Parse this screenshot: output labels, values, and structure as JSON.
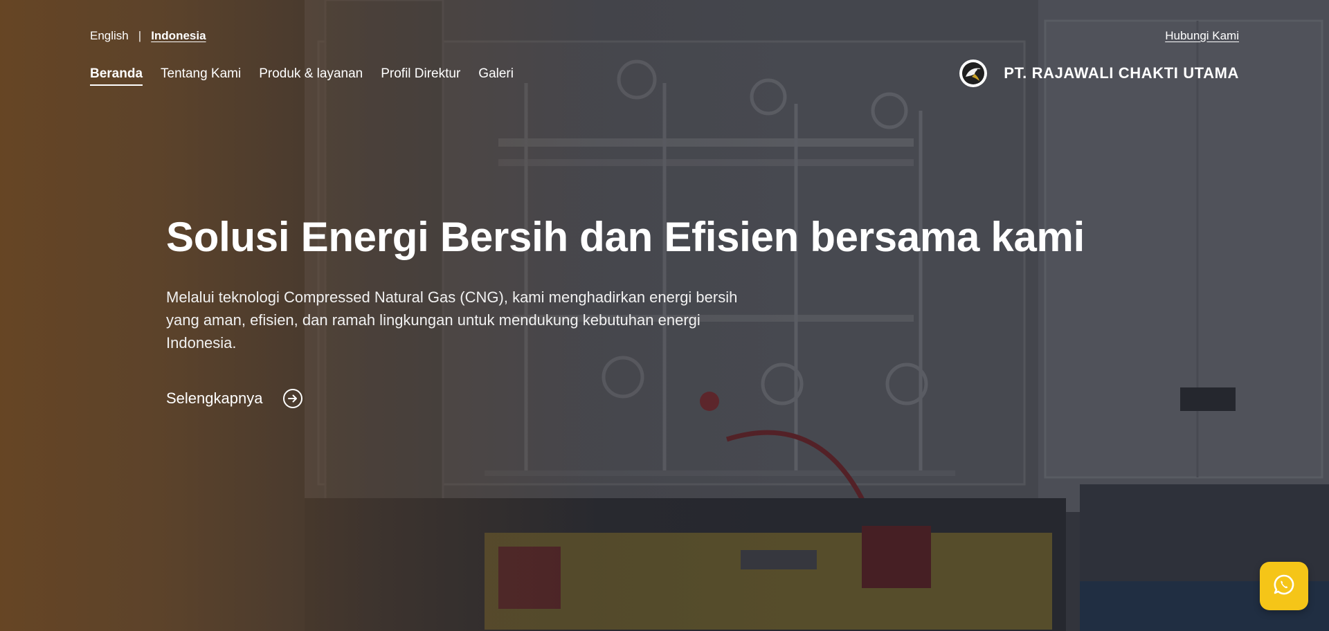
{
  "language_switcher": {
    "options": [
      {
        "label": "English",
        "active": false
      },
      {
        "label": "Indonesia",
        "active": true
      }
    ],
    "separator": "|"
  },
  "header": {
    "contact_label": "Hubungi Kami",
    "nav": [
      {
        "label": "Beranda",
        "active": true
      },
      {
        "label": "Tentang Kami",
        "active": false
      },
      {
        "label": "Produk & layanan",
        "active": false
      },
      {
        "label": "Profil Direktur",
        "active": false
      },
      {
        "label": "Galeri",
        "active": false
      }
    ],
    "brand_name": "PT. RAJAWALI CHAKTI UTAMA",
    "brand_logo_icon": "eagle-logo-icon"
  },
  "hero": {
    "title": "Solusi Energi Bersih dan Efisien bersama kami",
    "description": "Melalui teknologi Compressed Natural Gas (CNG), kami menghadirkan energi bersih yang aman, efisien, dan ramah lingkungan untuk mendukung kebutuhan energi Indonesia.",
    "cta_label": "Selengkapnya",
    "cta_icon": "arrow-right-circle-icon",
    "background_image": "cng-cylinder-container-photo"
  },
  "floating": {
    "whatsapp_icon": "whatsapp-icon",
    "accent_color": "#f5c518"
  },
  "colors": {
    "overlay_warm": "#68462a",
    "text": "#ffffff"
  }
}
